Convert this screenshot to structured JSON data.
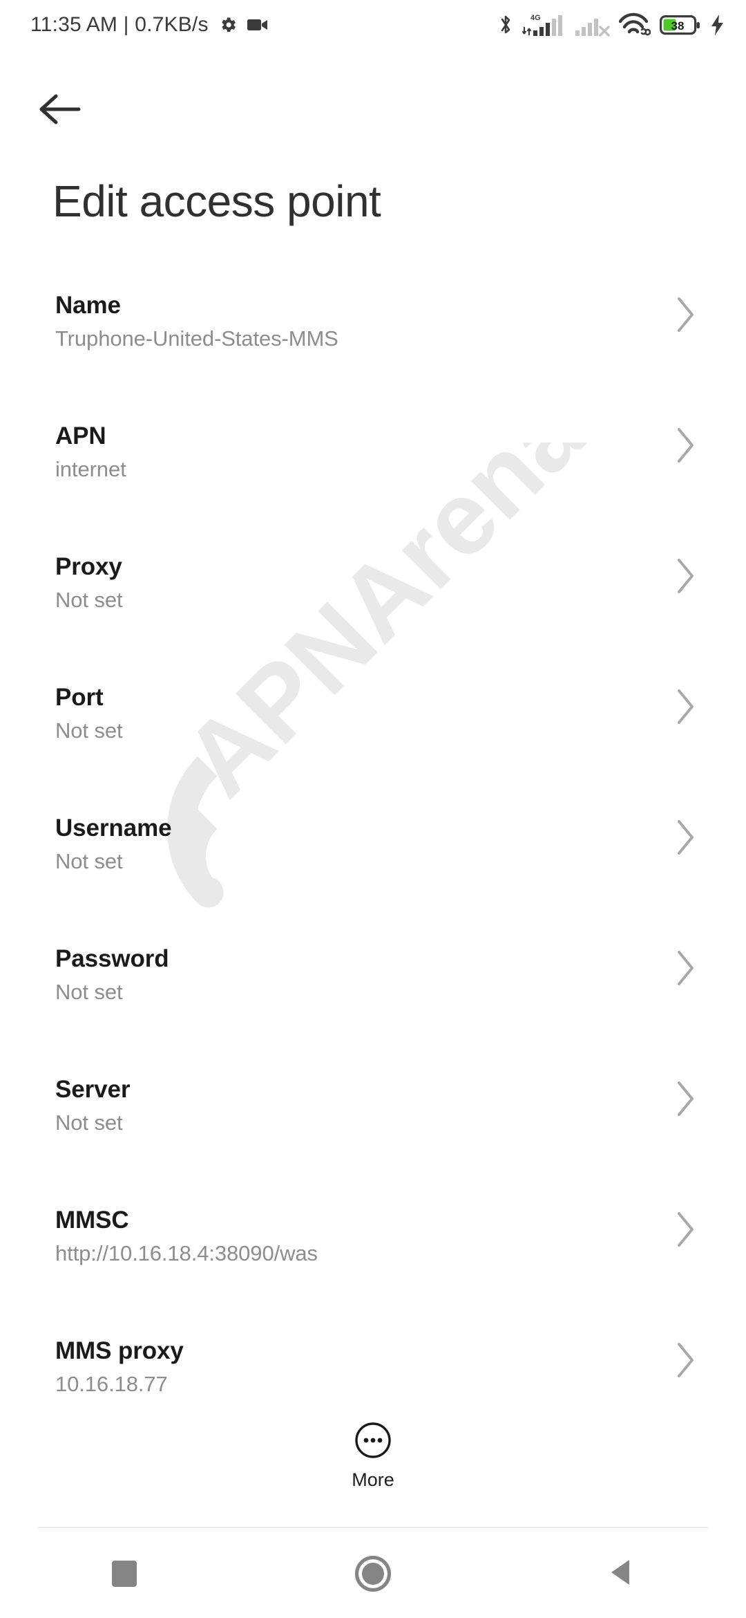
{
  "status_bar": {
    "clock_text": "11:35 AM | 0.7KB/s",
    "gear_icon": "gear-icon",
    "video_icon": "video-camera-icon",
    "bluetooth_icon": "bluetooth-icon",
    "network_type": "4G",
    "sim1_icon": "cellular-signal-sim1-icon",
    "sim2_icon": "cellular-signal-sim2-no-service-icon",
    "wifi_icon": "wifi-vpn-icon",
    "battery_level": "38",
    "battery_icon": "battery-icon",
    "charging_icon": "charging-bolt-icon",
    "battery_fill_color": "#4fc92a"
  },
  "header": {
    "back_icon": "back-arrow-icon",
    "title": "Edit access point"
  },
  "watermark": {
    "text": "APNArena",
    "icon": "wifi-arc-icon",
    "color": "#e9e9e9"
  },
  "list": {
    "chevron_icon": "chevron-right-icon",
    "rows": [
      {
        "label": "Name",
        "value": "Truphone-United-States-MMS"
      },
      {
        "label": "APN",
        "value": "internet"
      },
      {
        "label": "Proxy",
        "value": "Not set"
      },
      {
        "label": "Port",
        "value": "Not set"
      },
      {
        "label": "Username",
        "value": "Not set"
      },
      {
        "label": "Password",
        "value": "Not set"
      },
      {
        "label": "Server",
        "value": "Not set"
      },
      {
        "label": "MMSC",
        "value": "http://10.16.18.4:38090/was"
      },
      {
        "label": "MMS proxy",
        "value": "10.16.18.77"
      }
    ]
  },
  "more": {
    "label": "More",
    "icon": "more-dots-circle-icon"
  },
  "navbar": {
    "recents_icon": "recents-square-icon",
    "home_icon": "home-circle-icon",
    "back_icon": "back-triangle-icon",
    "color": "#858585"
  }
}
